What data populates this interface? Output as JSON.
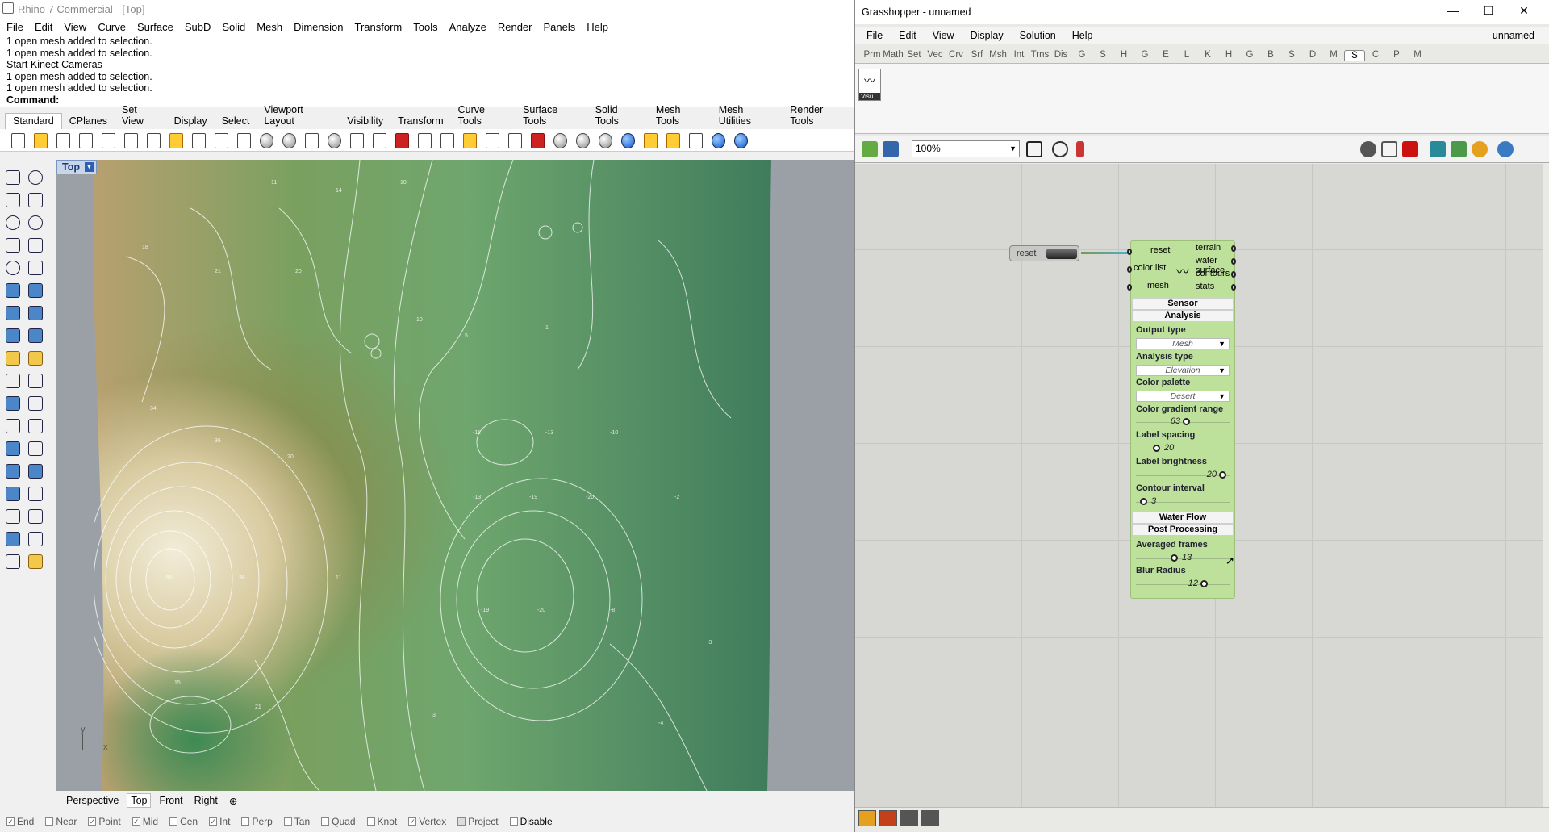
{
  "rhino": {
    "title": "Rhino 7 Commercial - [Top]",
    "menu": [
      "File",
      "Edit",
      "View",
      "Curve",
      "Surface",
      "SubD",
      "Solid",
      "Mesh",
      "Dimension",
      "Transform",
      "Tools",
      "Analyze",
      "Render",
      "Panels",
      "Help"
    ],
    "history": [
      "1 open mesh added to selection.",
      "1 open mesh added to selection.",
      "Start Kinect Cameras",
      "1 open mesh added to selection.",
      "1 open mesh added to selection."
    ],
    "command_label": "Command:",
    "toolbar_tabs": [
      "Standard",
      "CPlanes",
      "Set View",
      "Display",
      "Select",
      "Viewport Layout",
      "Visibility",
      "Transform",
      "Curve Tools",
      "Surface Tools",
      "Solid Tools",
      "Mesh Tools",
      "Mesh Utilities",
      "Render Tools"
    ],
    "viewport_label": "Top",
    "axis_y": "y",
    "axis_x": "x",
    "viewport_tabs": [
      "Perspective",
      "Top",
      "Front",
      "Right"
    ],
    "add_tab": "⊕",
    "osnaps": [
      {
        "label": "End",
        "checked": true
      },
      {
        "label": "Near",
        "checked": false
      },
      {
        "label": "Point",
        "checked": true
      },
      {
        "label": "Mid",
        "checked": true
      },
      {
        "label": "Cen",
        "checked": false
      },
      {
        "label": "Int",
        "checked": true
      },
      {
        "label": "Perp",
        "checked": false
      },
      {
        "label": "Tan",
        "checked": false
      },
      {
        "label": "Quad",
        "checked": false
      },
      {
        "label": "Knot",
        "checked": false
      },
      {
        "label": "Vertex",
        "checked": true
      },
      {
        "label": "Project",
        "checked": false
      },
      {
        "label": "Disable",
        "checked": false
      }
    ]
  },
  "gh": {
    "title": "Grasshopper - unnamed",
    "menu": [
      "File",
      "Edit",
      "View",
      "Display",
      "Solution",
      "Help"
    ],
    "doc_name": "unnamed",
    "tabs": [
      "Prm",
      "Math",
      "Set",
      "Vec",
      "Crv",
      "Srf",
      "Msh",
      "Int",
      "Trns",
      "Dis",
      "G",
      "S",
      "H",
      "G",
      "E",
      "L",
      "K",
      "H",
      "G",
      "B",
      "S",
      "D",
      "M",
      "S",
      "C",
      "P",
      "M"
    ],
    "active_tab": "S",
    "ribbon_component_label": "Visu...",
    "zoom": "100%",
    "button_comp": {
      "label": "reset"
    },
    "component": {
      "inputs": [
        "reset",
        "color list",
        "mesh"
      ],
      "outputs": [
        "terrain",
        "water surface",
        "contours",
        "stats"
      ],
      "sections": {
        "sensor": "Sensor",
        "analysis": "Analysis",
        "water_flow": "Water Flow",
        "post_processing": "Post Processing"
      },
      "output_type": {
        "label": "Output type",
        "value": "Mesh"
      },
      "analysis_type": {
        "label": "Analysis type",
        "value": "Elevation"
      },
      "color_palette": {
        "label": "Color palette",
        "value": "Desert"
      },
      "sliders": [
        {
          "label": "Color gradient range",
          "value": "63",
          "fraction": 0.56
        },
        {
          "label": "Label spacing",
          "value": "20",
          "fraction": 0.2
        },
        {
          "label": "Label brightness",
          "value": "20",
          "fraction": 1.0
        },
        {
          "label": "Contour interval",
          "value": "3",
          "fraction": 0.05
        },
        {
          "label": "Averaged frames",
          "value": "13",
          "fraction": 0.42
        },
        {
          "label": "Blur Radius",
          "value": "12",
          "fraction": 0.78
        }
      ]
    }
  }
}
